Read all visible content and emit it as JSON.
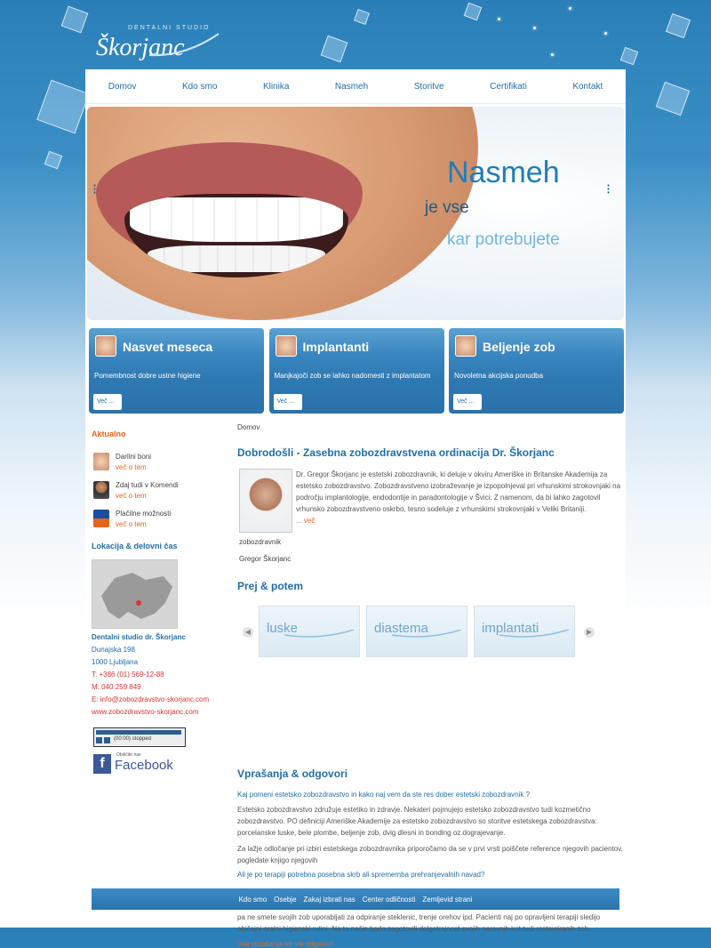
{
  "logo": {
    "studio": "DENTALNI STUDIO",
    "name": "Škorjanc"
  },
  "nav": [
    "Domov",
    "Kdo smo",
    "Klinika",
    "Nasmeh",
    "Storitve",
    "Certifikati",
    "Kontakt"
  ],
  "hero": {
    "title": "Nasmeh",
    "line1": "je vse",
    "line2": "kar potrebujete"
  },
  "boxes": [
    {
      "title": "Nasvet meseca",
      "desc": "Pomembnost dobre ustne higiene",
      "more": "Več ..."
    },
    {
      "title": "Implantanti",
      "desc": "Manjkajoči zob se lahko nadomesti z implantatom",
      "more": "Več ..."
    },
    {
      "title": "Beljenje zob",
      "desc": "Novoletna akcijska ponudba",
      "more": "Več ..."
    }
  ],
  "sidebar": {
    "aktualno_title": "Aktualno",
    "news": [
      {
        "title": "Darilni boni",
        "more": "več o tem"
      },
      {
        "title": "Zdaj tudi v Komendi",
        "more": "več o tem"
      },
      {
        "title": "Plačilne možnosti",
        "more": "več o tem"
      }
    ],
    "location_title": "Lokacija & delovni čas",
    "studio": "Dentalni studio dr. Škorjanc",
    "street": "Dunajska 198",
    "city": "1000 Ljubljana",
    "phone": "T: +386 (01) 569-12-88",
    "mobile": "M: 040 259 849",
    "email": "E: info@zobozdravstvo-skorjanc.com",
    "web": "www.zobozdravstvo-skorjanc.com",
    "player_status": "(00:00) stopped",
    "fb_small": "Obiščite nas",
    "fb_big": "Facebook"
  },
  "main": {
    "breadcrumb": "Domov",
    "title": "Dobrodošli - Zasebna zobozdravstvena ordinacija Dr. Škorjanc",
    "intro": "Dr. Gregor Škorjanc je estetski zobozdravnik, ki deluje v okviru Ameriške in Britanske Akademija za estetsko zobozdravstvo. Zobozdravstveno izobraževanje je izpopolnjeval pri vrhunskimi strokovnjaki na področju implantologije, endodontije in paradontologije v Švici. Z namenom, da bi lahko zagotovil vrhunsko zobozdravstveno oskrbo, tesno sodeluje z vrhunskimi strokovnjaki v Veliki Britaniji.",
    "intro_more": "... več",
    "caption_role": "zobozdravnik",
    "caption_name": "Gregor Škorjanc",
    "before_after_title": "Prej & potem",
    "slides": [
      "luske",
      "diastema",
      "implantati"
    ],
    "faq_title": "Vprašanja & odgovori",
    "q1": "Kaj pomeni estetsko zobozdravstvo in kako naj vem da ste res dober estetski zobozdravnik ?",
    "a1a": "Estetsko zobozdravstvo združuje estetiko in zdravje. Nekateri pojmujejo estetsko zobozdravstvo tudi kozmetično zobozdravstvo. PO definiciji Ameriške Akademije za estetsko zobozdravstvo so storitve estetskega zobozdravstva: porcelanske luske, bele plombe, beljenje zob, dvig dlesni  in  bonding oz.dograjevanje.",
    "a1b": "Za lažje odločanje pri izbiri estetskega zobozdravnika priporočamo da se v prvi vrsti poiščete reference njegovih pacientov, pogledate knjigo njegovih",
    "q2": "Ali je po terapiji potrebna posebna skrb ali sprememba prehranjevalnih navad?",
    "a2": "Porcelanske luske in krone se ne zabarvajo in so oblikovane tako, da se izrabljajo na enak način kot naravni zobje. Nikoli pa ne smete svojih zob uporabljati za odpiranje steklenic, trenje orehov ipd. Pacienti naj po opravljeni terapiji sledijo običajni oralni higienski rutini. Na ta način bodo zagotovili dolgotrajnost svojih naravnih kot tudi restavriranih zob.",
    "all_questions": "Vsa vprašanja ter vsi odgovori"
  },
  "footer": [
    "Kdo smo",
    "Osebje",
    "Zakaj izbrati nas",
    "Center odličnosti",
    "Zemljevid strani"
  ],
  "colors": {
    "accent": "#1f6fa8",
    "orange": "#e8631c",
    "header_bg": "#2a7fb8"
  }
}
